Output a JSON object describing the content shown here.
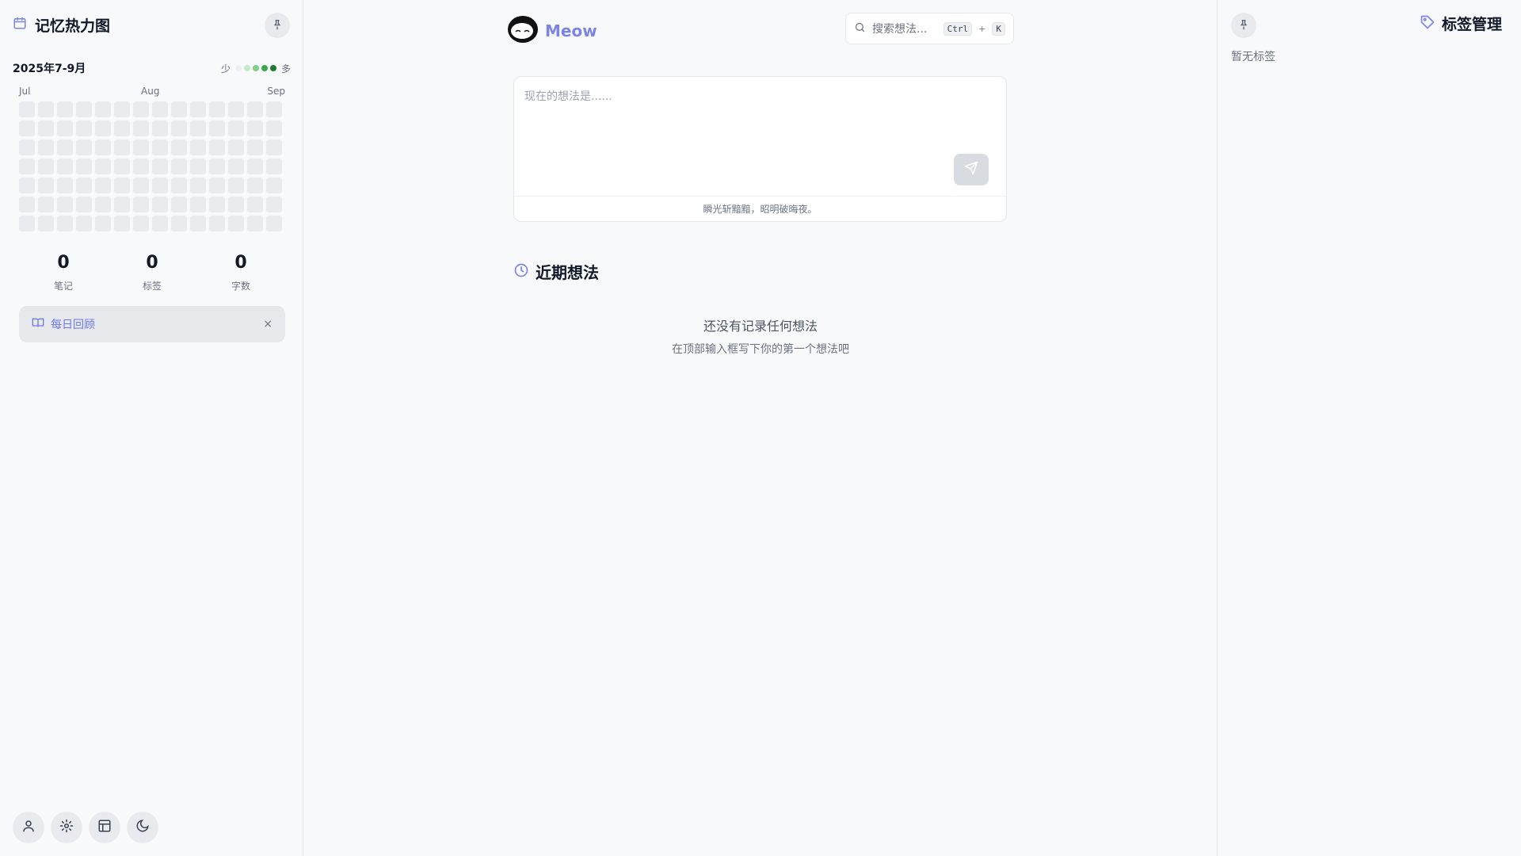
{
  "left": {
    "title": "记忆热力图",
    "range": "2025年7-9月",
    "legend": {
      "less": "少",
      "more": "多",
      "colors": [
        "#eef0f3",
        "#c6e9c9",
        "#7fcf85",
        "#3aa84a",
        "#1f7a2f"
      ]
    },
    "months": [
      "Jul",
      "Aug",
      "Sep"
    ],
    "stats": [
      {
        "value": "0",
        "label": "笔记"
      },
      {
        "value": "0",
        "label": "标签"
      },
      {
        "value": "0",
        "label": "字数"
      }
    ],
    "review": {
      "label": "每日回顾",
      "close": "×"
    }
  },
  "center": {
    "brand": "Meow",
    "search": {
      "placeholder": "搜索想法...",
      "key1": "Ctrl",
      "plus": "+",
      "key2": "K"
    },
    "composer": {
      "placeholder": "现在的想法是......",
      "footer": "瞬光斩黯黯，昭明破晦夜。"
    },
    "recent_title": "近期想法",
    "empty_title": "还没有记录任何想法",
    "empty_hint": "在顶部输入框写下你的第一个想法吧"
  },
  "right": {
    "title": "标签管理",
    "empty": "暂无标签"
  },
  "colors": {
    "accent": "#7c85e6"
  }
}
